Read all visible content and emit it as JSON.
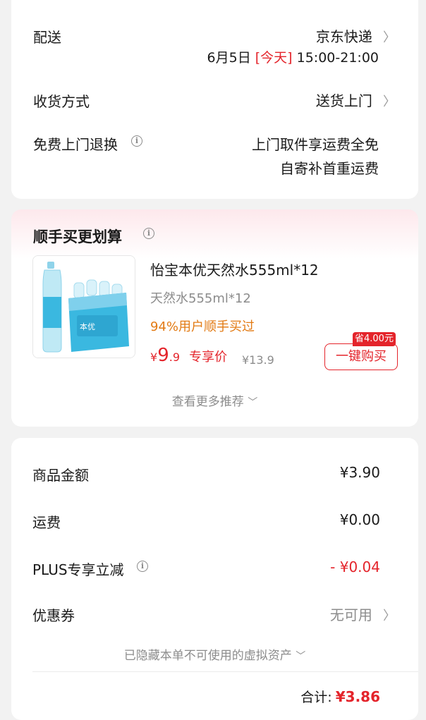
{
  "delivery": {
    "label": "配送",
    "carrier": "京东快递",
    "date": "6月5日",
    "today_tag": "[今天]",
    "time_window": "15:00-21:00"
  },
  "receive": {
    "label": "收货方式",
    "value": "送货上门"
  },
  "free_return": {
    "label": "免费上门退换",
    "line1": "上门取件享运费全免",
    "line2": "自寄补首重运费"
  },
  "recommend": {
    "title": "顺手买更划算",
    "product_name": "怡宝本优天然水555ml*12",
    "spec": "天然水555ml*12",
    "buyers_note": "94%用户顺手买过",
    "currency": "¥",
    "price_int": "9",
    "price_dec": ".9",
    "price_tag": "专享价",
    "original_price": "¥13.9",
    "save_badge": "省4.00元",
    "buy_button": "一键购买",
    "more": "查看更多推荐"
  },
  "summary": {
    "goods_amount_label": "商品金额",
    "goods_amount": "¥3.90",
    "shipping_label": "运费",
    "shipping": "¥0.00",
    "plus_label": "PLUS专享立减",
    "plus_discount": "- ¥0.04",
    "coupon_label": "优惠券",
    "coupon_value": "无可用",
    "hidden_note": "已隐藏本单不可使用的虚拟资产",
    "total_label": "合计:",
    "total": "¥3.86"
  },
  "colors": {
    "accent_red": "#e4242b",
    "accent_orange": "#e27a13",
    "page_bg": "#f2f2f2"
  }
}
